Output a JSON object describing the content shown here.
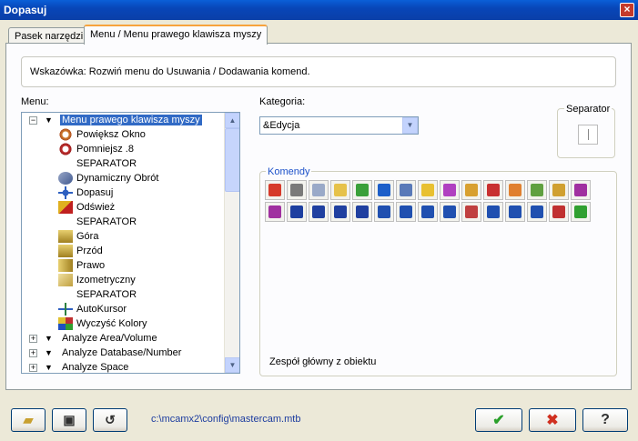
{
  "window": {
    "title": "Dopasuj"
  },
  "tabs": [
    {
      "label": "Pasek narzędzi"
    },
    {
      "label": "Menu / Menu prawego klawisza myszy"
    }
  ],
  "hint": "Wskazówka:  Rozwiń menu do Usuwania / Dodawania komend.",
  "menu": {
    "label": "Menu:",
    "items": [
      {
        "label": "Menu prawego klawisza myszy",
        "icon": "menu-root-icon"
      },
      {
        "label": "Powiększ Okno",
        "icon": "zoom-window-icon"
      },
      {
        "label": "Pomniejsz .8",
        "icon": "unzoom-icon"
      },
      {
        "label": "SEPARATOR",
        "icon": ""
      },
      {
        "label": "Dynamiczny Obrót",
        "icon": "dynamic-rotate-icon"
      },
      {
        "label": "Dopasuj",
        "icon": "fit-icon"
      },
      {
        "label": "Odśwież",
        "icon": "refresh-icon"
      },
      {
        "label": "SEPARATOR",
        "icon": ""
      },
      {
        "label": "Góra",
        "icon": "top-view-icon"
      },
      {
        "label": "Przód",
        "icon": "front-view-icon"
      },
      {
        "label": "Prawo",
        "icon": "right-view-icon"
      },
      {
        "label": "Izometryczny",
        "icon": "isometric-view-icon"
      },
      {
        "label": "SEPARATOR",
        "icon": ""
      },
      {
        "label": "AutoKursor",
        "icon": "autocursor-icon"
      },
      {
        "label": "Wyczyść Kolory",
        "icon": "clear-colors-icon"
      },
      {
        "label": "Analyze Area/Volume",
        "icon": ""
      },
      {
        "label": "Analyze Database/Number",
        "icon": ""
      },
      {
        "label": "Analyze Space",
        "icon": ""
      }
    ]
  },
  "category": {
    "label": "Kategoria:",
    "value": "&Edycja"
  },
  "separator": {
    "label": "Separator"
  },
  "commands": {
    "label": "Komendy",
    "description": "Zespół główny z obiektu",
    "row1": [
      {
        "icon": "grid-icon",
        "color": "#d63a2a"
      },
      {
        "icon": "scissors-icon",
        "color": "#7a7a7a"
      },
      {
        "icon": "copy-icon",
        "color": "#9aaac8"
      },
      {
        "icon": "paste-icon",
        "color": "#e6c24a"
      },
      {
        "icon": "check-pen-icon",
        "color": "#3aa03a"
      },
      {
        "icon": "plus-circle-icon",
        "color": "#1d5fc9"
      },
      {
        "icon": "arrow-icon",
        "color": "#5a7ab8"
      },
      {
        "icon": "pencil-icon",
        "color": "#e8c030"
      },
      {
        "icon": "pencil-purple-icon",
        "color": "#b040c0"
      },
      {
        "icon": "pencils-icon",
        "color": "#d8a030"
      },
      {
        "icon": "pencils-red-icon",
        "color": "#c83030"
      },
      {
        "icon": "pencil-blue-icon",
        "color": "#e08030"
      },
      {
        "icon": "pencil-green-icon",
        "color": "#60a040"
      },
      {
        "icon": "pencil-mix-icon",
        "color": "#d0a030"
      },
      {
        "icon": "undo-icon",
        "color": "#a030a0"
      }
    ],
    "row2": [
      {
        "icon": "redo-icon",
        "color": "#a030a0"
      },
      {
        "icon": "chain-icon",
        "color": "#1d3fa0"
      },
      {
        "icon": "trim-icon",
        "color": "#2040a0"
      },
      {
        "icon": "break-icon",
        "color": "#2040a0"
      },
      {
        "icon": "break-many-icon",
        "color": "#2040a0"
      },
      {
        "icon": "join-icon",
        "color": "#2050b0"
      },
      {
        "icon": "modify-node-icon",
        "color": "#2050b0"
      },
      {
        "icon": "rotate-icon",
        "color": "#2050b0"
      },
      {
        "icon": "grid-lines-icon",
        "color": "#2050b0"
      },
      {
        "icon": "hatch-icon",
        "color": "#c04040"
      },
      {
        "icon": "circle-gear-icon",
        "color": "#2050b0"
      },
      {
        "icon": "nodes-icon",
        "color": "#2050b0"
      },
      {
        "icon": "pattern-icon",
        "color": "#2050b0"
      },
      {
        "icon": "box-red-icon",
        "color": "#c03030"
      },
      {
        "icon": "box-green-icon",
        "color": "#30a030"
      }
    ]
  },
  "footer": {
    "path": "c:\\mcamx2\\config\\mastercam.mtb",
    "ok_icon": "✔",
    "cancel_icon": "✖",
    "help_icon": "?"
  }
}
